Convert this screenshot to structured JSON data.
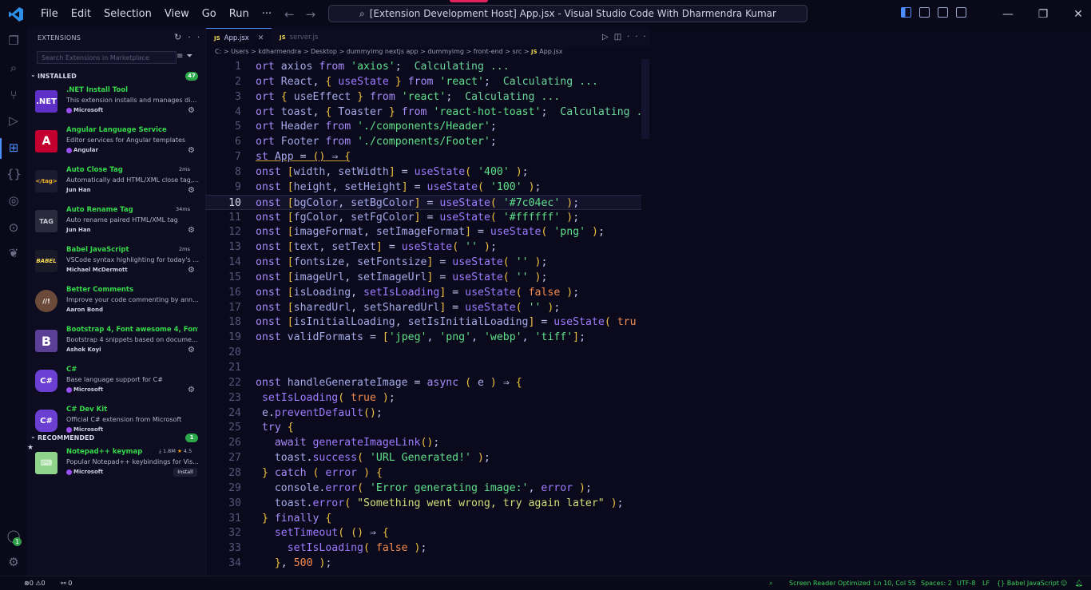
{
  "window": {
    "title": "[Extension Development Host] App.jsx - Visual Studio Code With Dharmendra Kumar",
    "menu": [
      "File",
      "Edit",
      "Selection",
      "View",
      "Go",
      "Run",
      "···"
    ]
  },
  "activity_bar": [
    "explorer-icon",
    "search-icon",
    "source-control-icon",
    "run-debug-icon",
    "extensions-icon",
    "json-icon",
    "github-actions-icon",
    "timeline-icon",
    "mongodb-leaf-icon",
    "account-icon",
    "settings-gear-icon"
  ],
  "sidebar": {
    "title": "EXTENSIONS",
    "search_placeholder": "Search Extensions in Marketplace",
    "installed_label": "INSTALLED",
    "installed_count": "47",
    "recommended_label": "RECOMMENDED",
    "recommended_count": "1",
    "extensions": [
      {
        "name": ".NET Install Tool",
        "desc": "This extension installs and manages diff...",
        "publisher": "Microsoft",
        "verified": true,
        "icon_text": ".NET",
        "icon_color": "#5f30c8",
        "time": ""
      },
      {
        "name": "Angular Language Service",
        "desc": "Editor services for Angular templates",
        "publisher": "Angular",
        "verified": true,
        "icon_text": "A",
        "icon_color": "#c3002f",
        "time": ""
      },
      {
        "name": "Auto Close Tag",
        "desc": "Automatically add HTML/XML close tag,...",
        "publisher": "Jun Han",
        "verified": false,
        "icon_text": "</tag>",
        "icon_color": "#1b1a30",
        "time": "2ms"
      },
      {
        "name": "Auto Rename Tag",
        "desc": "Auto rename paired HTML/XML tag",
        "publisher": "Jun Han",
        "verified": false,
        "icon_text": "TAG",
        "icon_color": "#2b2a3d",
        "time": "34ms"
      },
      {
        "name": "Babel JavaScript",
        "desc": "VSCode syntax highlighting for today's J...",
        "publisher": "Michael McDermott",
        "verified": false,
        "icon_text": "BABEL",
        "icon_color": "#1a1928",
        "time": "2ms"
      },
      {
        "name": "Better Comments",
        "desc": "Improve your code commenting by ann...",
        "publisher": "Aaron Bond",
        "verified": false,
        "icon_text": "//!",
        "icon_color": "#6b4a3a",
        "time": ""
      },
      {
        "name": "Bootstrap 4, Font awesome 4, Font A...",
        "desc": "Bootstrap 4 snippets based on docume...",
        "publisher": "Ashok Koyi",
        "verified": false,
        "icon_text": "B",
        "icon_color": "#5b3e96",
        "time": ""
      },
      {
        "name": "C#",
        "desc": "Base language support for C#",
        "publisher": "Microsoft",
        "verified": true,
        "icon_text": "C#",
        "icon_color": "#6a3fd1",
        "time": ""
      },
      {
        "name": "C# Dev Kit",
        "desc": "Official C# extension from Microsoft",
        "publisher": "Microsoft",
        "verified": true,
        "icon_text": "C#",
        "icon_color": "#6a3fd1",
        "time": ""
      }
    ],
    "recommended": [
      {
        "name": "Notepad++ keymap",
        "desc": "Popular Notepad++ keybindings for Vis...",
        "publisher": "Microsoft",
        "verified": true,
        "installs": "1.8M",
        "rating": "4.5",
        "install_label": "Install"
      }
    ]
  },
  "editor": {
    "tabs": [
      {
        "label": "App.jsx",
        "active": true
      },
      {
        "label": "server.js",
        "active": false
      }
    ],
    "breadcrumb": [
      "C:",
      "Users",
      "kdharmendra",
      "Desktop",
      "dummyimg nextjs app",
      "dummyimg",
      "front-end",
      "src",
      "App.jsx"
    ],
    "current_line": 10,
    "line_numbers": [
      "1",
      "2",
      "3",
      "4",
      "5",
      "6",
      "7",
      "8",
      "9",
      "10",
      "11",
      "12",
      "13",
      "14",
      "15",
      "16",
      "17",
      "18",
      "19",
      "20",
      "21",
      "22",
      "23",
      "24",
      "25",
      "26",
      "27",
      "28",
      "29",
      "30",
      "31",
      "32",
      "33",
      "34"
    ],
    "lines": [
      "ort axios from 'axios';  Calculating ...",
      "ort React, { useState } from 'react';  Calculating ...",
      "ort { useEffect } from 'react';  Calculating ...",
      "ort toast, { Toaster } from 'react-hot-toast';  Calculating ...",
      "ort Header from './components/Header';",
      "ort Footer from './components/Footer';",
      "st App = () ⇒ {",
      "onst [width, setWidth] = useState( '400' );",
      "onst [height, setHeight] = useState( '100' );",
      "onst [bgColor, setBgColor] = useState( '#7c04ec' );",
      "onst [fgColor, setFgColor] = useState( '#ffffff' );",
      "onst [imageFormat, setImageFormat] = useState( 'png' );",
      "onst [text, setText] = useState( '' );",
      "onst [fontsize, setFontsize] = useState( '' );",
      "onst [imageUrl, setImageUrl] = useState( '' );",
      "onst [isLoading, setIsLoading] = useState( false );",
      "onst [sharedUrl, setSharedUrl] = useState( '' );",
      "onst [isInitialLoading, setIsInitialLoading] = useState( tru",
      "onst validFormats = ['jpeg', 'png', 'webp', 'tiff'];",
      "",
      "",
      "onst handleGenerateImage = async ( e ) ⇒ {",
      " setIsLoading( true );",
      " e.preventDefault();",
      " try {",
      "   await generateImageLink();",
      "   toast.success( 'URL Generated!' );",
      " } catch ( error ) {",
      "   console.error( 'Error generating image:', error );",
      "   toast.error( \"Something went wrong, try again later\" );",
      " } finally {",
      "   setTimeout( () ⇒ {",
      "     setIsLoading( false );",
      "   }, 500 );"
    ]
  },
  "statusbar": {
    "errors": "0",
    "warnings": "0",
    "ports": "0",
    "screen_reader": "Screen Reader Optimized",
    "position": "Ln 10, Col 55",
    "spaces": "Spaces: 2",
    "encoding": "UTF-8",
    "eol": "LF",
    "language": "Babel JavaScript"
  }
}
